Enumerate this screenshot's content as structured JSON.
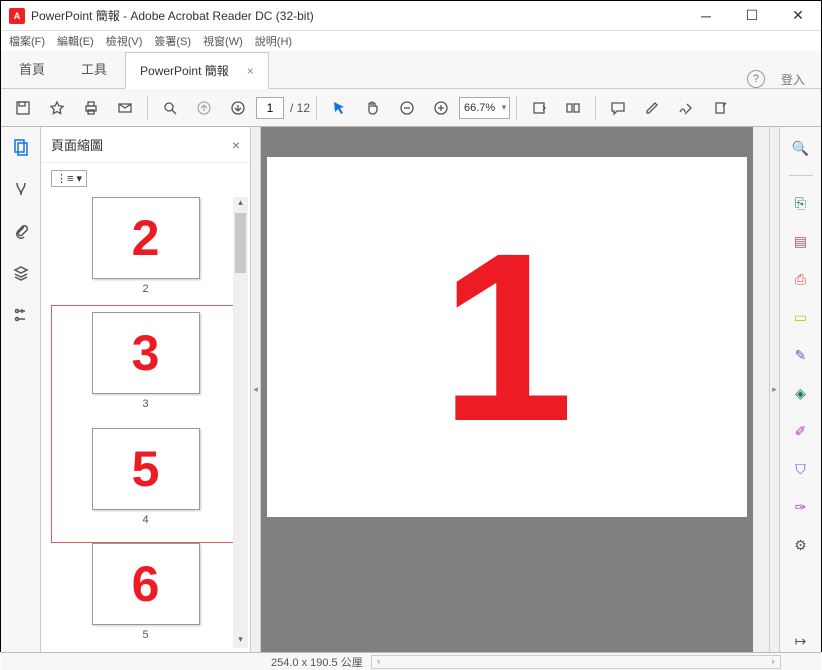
{
  "window": {
    "title": "PowerPoint 簡報 - Adobe Acrobat Reader DC (32-bit)",
    "app_icon_letter": "A"
  },
  "menu": {
    "file": "檔案(F)",
    "edit": "編輯(E)",
    "view": "檢視(V)",
    "sign": "簽署(S)",
    "window": "視窗(W)",
    "help": "說明(H)"
  },
  "tabs": {
    "home": "首頁",
    "tools": "工具",
    "file": "PowerPoint 簡報",
    "close": "×",
    "login": "登入",
    "help_icon": "?"
  },
  "toolbar": {
    "page_current": "1",
    "page_total": "/ 12",
    "zoom": "66.7%"
  },
  "thumbnails": {
    "title": "頁面縮圖",
    "close": "×",
    "options": "⋮≡ ▾",
    "items": [
      {
        "display": "2",
        "label": "2",
        "selected": false
      },
      {
        "display": "3",
        "label": "3",
        "selected": true
      },
      {
        "display": "5",
        "label": "4",
        "selected": true
      },
      {
        "display": "6",
        "label": "5",
        "selected": false
      }
    ]
  },
  "main": {
    "display": "1"
  },
  "status": {
    "dims": "254.0 x 190.5 公厘",
    "arrow_l": "‹",
    "arrow_r": "›"
  },
  "right_rail": {
    "search": "🔍",
    "export": "📄",
    "edit": "📋",
    "create": "📑",
    "comment": "💬",
    "fill": "📝",
    "stamp": "🔖",
    "measure": "📐",
    "protect": "🛡",
    "more": "🛠",
    "expand": "↦"
  }
}
